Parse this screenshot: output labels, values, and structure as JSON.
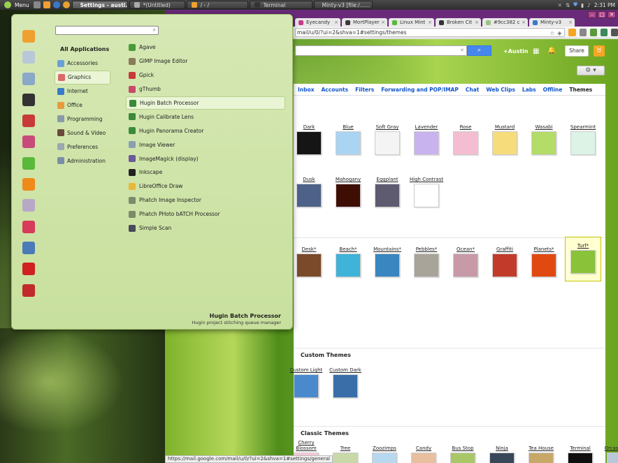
{
  "top_panel": {
    "menu_label": "Menu",
    "tasks": [
      {
        "label": "Settings - austi...",
        "active": true
      },
      {
        "label": "*(Untitled)",
        "active": false
      },
      {
        "label": "/ - /",
        "active": false
      },
      {
        "label": "Terminal",
        "active": false
      },
      {
        "label": "Minty-v3 [file:/......",
        "active": false
      }
    ],
    "clock": "2:31 PM"
  },
  "browser": {
    "tabs": [
      {
        "label": "Eyecandy"
      },
      {
        "label": "MortPlayer"
      },
      {
        "label": "Linux Mint"
      },
      {
        "label": "Broken Cit"
      },
      {
        "label": "#9cc382 c"
      },
      {
        "label": "Minty-v3"
      }
    ],
    "url": "mail/u/0/?ui=2&shva=1#settings/themes",
    "status_url": "https://mail.google.com/mail/u/0/?ui=2&shva=1#settings/general"
  },
  "gmail": {
    "user": "+Austin",
    "share": "Share",
    "settings_tabs": [
      "Inbox",
      "Accounts",
      "Filters",
      "Forwarding and POP/IMAP",
      "Chat",
      "Web Clips",
      "Labs",
      "Offline",
      "Themes"
    ],
    "selected_tab": "Themes",
    "basic_row1": [
      {
        "name": "Dark",
        "color": "#151515"
      },
      {
        "name": "Blue",
        "color": "#a9d4f2"
      },
      {
        "name": "Soft Gray",
        "color": "#f4f4f4"
      },
      {
        "name": "Lavender",
        "color": "#c9b3ee"
      },
      {
        "name": "Rose",
        "color": "#f5bdd1"
      },
      {
        "name": "Mustard",
        "color": "#f6dc7a"
      },
      {
        "name": "Wasabi",
        "color": "#b3dc69"
      },
      {
        "name": "Spearmint",
        "color": "#dcf3e6"
      }
    ],
    "basic_row2": [
      {
        "name": "Dusk",
        "color": "#4d6189"
      },
      {
        "name": "Mahogany",
        "color": "#3e0e05"
      },
      {
        "name": "Eggplant",
        "color": "#5e5a70"
      },
      {
        "name": "High Contrast",
        "color": "#ffffff"
      }
    ],
    "hd_row": [
      {
        "name": "Desk*",
        "color": "#7a4a2a"
      },
      {
        "name": "Beach*",
        "color": "#3fb3d8"
      },
      {
        "name": "Mountains*",
        "color": "#3a86c0"
      },
      {
        "name": "Pebbles*",
        "color": "#a9a49a"
      },
      {
        "name": "Ocean*",
        "color": "#c89aa8"
      },
      {
        "name": "Graffiti",
        "color": "#c23a2a"
      },
      {
        "name": "Planets*",
        "color": "#e04a10"
      },
      {
        "name": "Turf*",
        "color": "#8ac23a"
      }
    ],
    "selected_theme": "Turf*",
    "custom_title": "Custom Themes",
    "custom": [
      {
        "name": "Custom Light",
        "color": "#4a8acc"
      },
      {
        "name": "Custom Dark",
        "color": "#3a6ea8"
      }
    ],
    "classic_title": "Classic Themes",
    "classic": [
      {
        "name": "Cherry Blossom",
        "color": "#f4c8d6"
      },
      {
        "name": "Tree",
        "color": "#c8d8a8"
      },
      {
        "name": "Zoozimps",
        "color": "#b8d8f0"
      },
      {
        "name": "Candy",
        "color": "#e8c0a0"
      },
      {
        "name": "Bus Stop",
        "color": "#a8c868"
      },
      {
        "name": "Ninja",
        "color": "#384858"
      },
      {
        "name": "Tea House",
        "color": "#c8a868"
      },
      {
        "name": "Terminal",
        "color": "#101010"
      },
      {
        "name": "Orcas Island",
        "color": "#b8c8d8"
      }
    ]
  },
  "menu": {
    "search_placeholder": "",
    "all_apps": "All Applications",
    "categories": [
      {
        "label": "Accessories",
        "icon": "accessories-icon",
        "color": "#6aa0d8"
      },
      {
        "label": "Graphics",
        "icon": "graphics-icon",
        "color": "#d86a6a",
        "selected": true
      },
      {
        "label": "Internet",
        "icon": "internet-icon",
        "color": "#3a78c8"
      },
      {
        "label": "Office",
        "icon": "office-icon",
        "color": "#e89a3a"
      },
      {
        "label": "Programming",
        "icon": "programming-icon",
        "color": "#8a9aa8"
      },
      {
        "label": "Sound & Video",
        "icon": "sound-video-icon",
        "color": "#6a4a3a"
      },
      {
        "label": "Preferences",
        "icon": "preferences-icon",
        "color": "#9aa8b0"
      },
      {
        "label": "Administration",
        "icon": "administration-icon",
        "color": "#7890a8"
      }
    ],
    "apps": [
      {
        "label": "Agave",
        "icon": "agave-icon",
        "color": "#4a9a3a"
      },
      {
        "label": "GIMP Image Editor",
        "icon": "gimp-icon",
        "color": "#8a7a5a"
      },
      {
        "label": "Gpick",
        "icon": "gpick-icon",
        "color": "#c83a3a"
      },
      {
        "label": "gThumb",
        "icon": "gthumb-icon",
        "color": "#c84a6a"
      },
      {
        "label": "Hugin Batch Processor",
        "icon": "hugin-icon",
        "color": "#3a8a3a",
        "selected": true
      },
      {
        "label": "Hugin Calibrate Lens",
        "icon": "hugin-icon",
        "color": "#3a8a3a"
      },
      {
        "label": "Hugin Panorama Creator",
        "icon": "hugin-icon",
        "color": "#3a8a3a"
      },
      {
        "label": "Image Viewer",
        "icon": "image-viewer-icon",
        "color": "#8aa0b0"
      },
      {
        "label": "ImageMagick (display)",
        "icon": "imagemagick-icon",
        "color": "#6a5a9a"
      },
      {
        "label": "Inkscape",
        "icon": "inkscape-icon",
        "color": "#222222"
      },
      {
        "label": "LibreOffice Draw",
        "icon": "libreoffice-draw-icon",
        "color": "#e8b83a"
      },
      {
        "label": "Phatch Image Inspector",
        "icon": "phatch-icon",
        "color": "#7a8a6a"
      },
      {
        "label": "Phatch PHoto bATCH Processor",
        "icon": "phatch-icon",
        "color": "#7a8a6a"
      },
      {
        "label": "Simple Scan",
        "icon": "scanner-icon",
        "color": "#4a4a5a"
      }
    ],
    "favorites": [
      {
        "icon": "folder-icon",
        "color": "#f0a030"
      },
      {
        "icon": "search-icon",
        "color": "#b8c8d8"
      },
      {
        "icon": "find-file-icon",
        "color": "#8aa8c8"
      },
      {
        "icon": "terminal-icon",
        "color": "#333333"
      },
      {
        "icon": "software-manager-icon",
        "color": "#c83a3a"
      },
      {
        "icon": "package-icon",
        "color": "#c84a7a"
      },
      {
        "icon": "text-editor-icon",
        "color": "#5ab83a"
      },
      {
        "icon": "vlc-icon",
        "color": "#f08a1a"
      },
      {
        "icon": "color-picker-icon",
        "color": "#b8a8c8"
      },
      {
        "icon": "disk-icon",
        "color": "#d83a5a"
      },
      {
        "icon": "computer-icon",
        "color": "#4a7ab8"
      },
      {
        "icon": "power-icon",
        "color": "#d02020"
      },
      {
        "icon": "logout-icon",
        "color": "#c02a2a"
      }
    ],
    "description_title": "Hugin Batch Processor",
    "description_text": "Hugin project stitching queue manager"
  }
}
